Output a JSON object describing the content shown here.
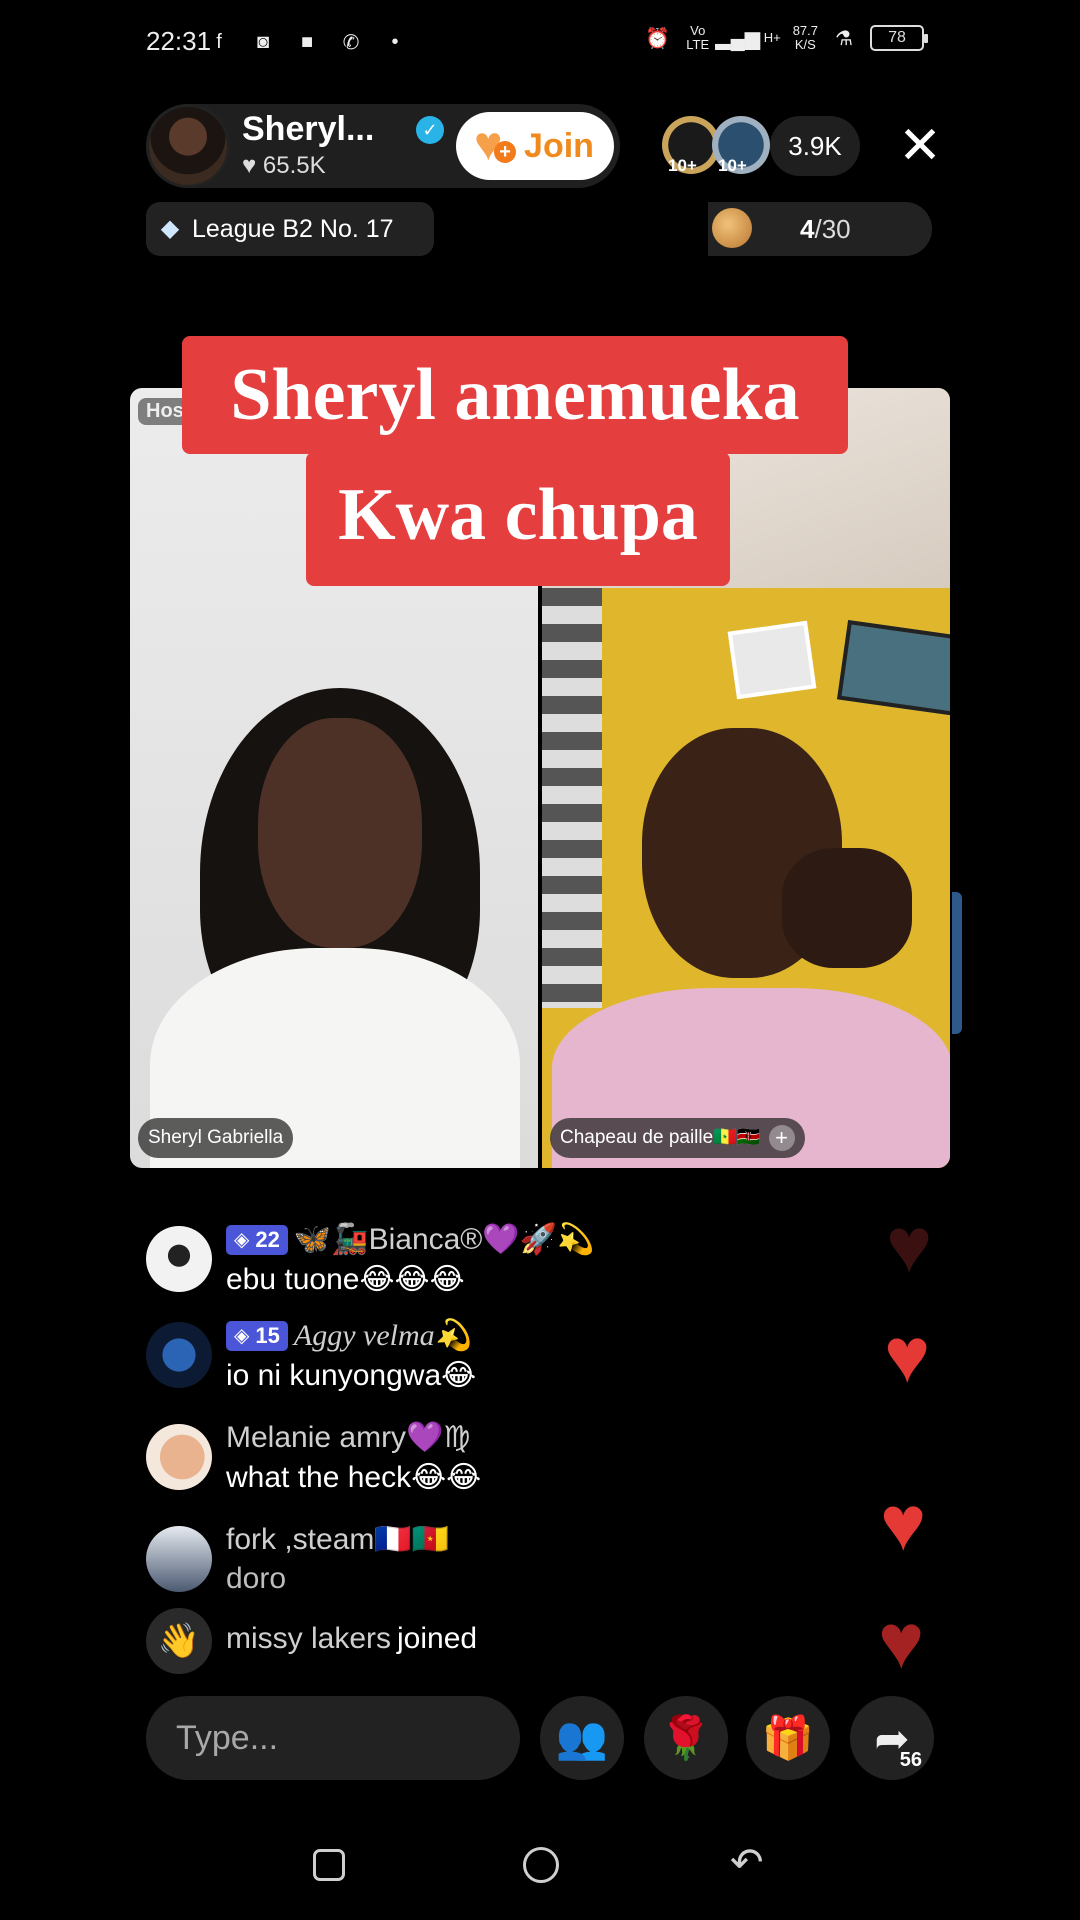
{
  "status_bar": {
    "time": "22:31",
    "net_speed": "87.7",
    "net_unit": "K/S",
    "volte": "Vo LTE",
    "network": "H+",
    "battery": "78"
  },
  "host": {
    "name": "Sheryl...",
    "likes": "65.5K",
    "join_label": "Join"
  },
  "viewers": {
    "badge_1": "10+",
    "badge_2": "10+",
    "count": "3.9K"
  },
  "league": {
    "label": "League B2 No. 17"
  },
  "goal": {
    "current": "4",
    "total": "/30"
  },
  "caption": {
    "line1": "Sheryl amemueka",
    "line2": "Kwa chupa"
  },
  "videos": {
    "host_tag": "Hos",
    "left_name": "Sheryl Gabriella",
    "right_name": "Chapeau de paille🇸🇳🇰🇪"
  },
  "chat": [
    {
      "level": "22",
      "name": "🦋🚂Bianca®💜🚀💫",
      "message": "ebu tuone😂😂😂"
    },
    {
      "level": "15",
      "name": "Aggy velma💫",
      "message": "io ni kunyongwa😂"
    },
    {
      "level": "",
      "name": "Melanie amry💜♍",
      "message": "what the heck😂😂"
    },
    {
      "level": "",
      "name": "fork ,steam🇫🇷🇨🇲",
      "message": "doro"
    }
  ],
  "joined": {
    "user": "missy lakers",
    "suffix": "joined"
  },
  "bottom_bar": {
    "input_placeholder": "Type...",
    "share_count": "56"
  },
  "colors": {
    "caption_bg": "#e53e3e",
    "join_text": "#f08a1c",
    "level_badge": "#4a55d8",
    "heart": "#e53935",
    "verified": "#2ab3e6"
  }
}
